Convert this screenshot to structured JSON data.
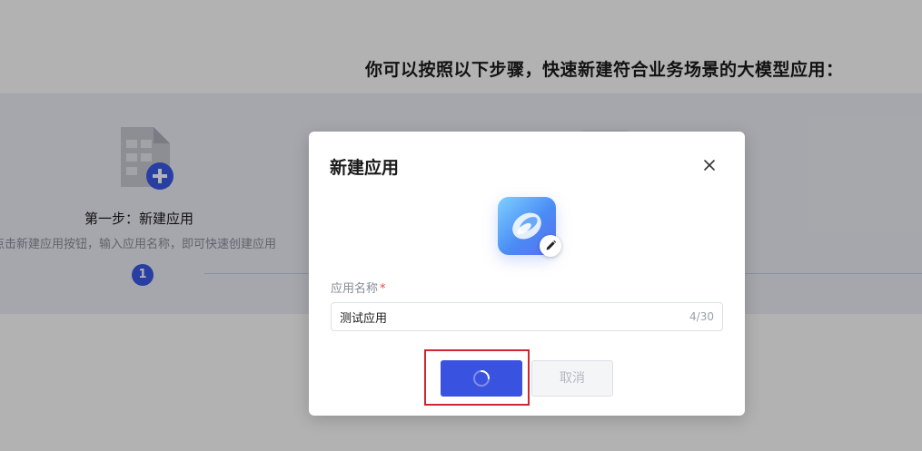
{
  "page": {
    "heading": "你可以按照以下步骤，快速新建符合业务场景的大模型应用：",
    "steps": [
      {
        "number": "1",
        "title": "第一步：新建应用",
        "description": "点击新建应用按钮，输入应用名称，即可快速创建应用",
        "icon": "document-add-icon"
      }
    ]
  },
  "modal": {
    "title": "新建应用",
    "close_icon": "close-icon",
    "avatar_icon": "app-avatar-swirl-icon",
    "edit_icon": "pencil-icon",
    "field_label": "应用名称",
    "required_mark": "*",
    "input_value": "测试应用",
    "char_count": "4/30",
    "confirm_state": "loading",
    "cancel_label": "取消"
  },
  "colors": {
    "primary": "#3a52e0",
    "required": "#e5484d",
    "highlight": "#d1262f",
    "step_band": "#eef0f6"
  }
}
